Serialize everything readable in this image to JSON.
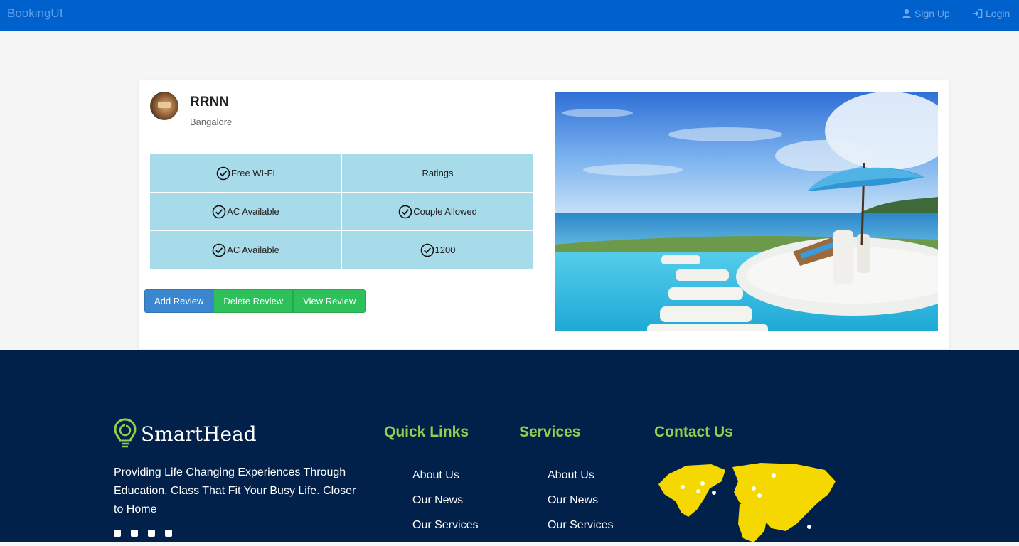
{
  "navbar": {
    "brand": "BookingUI",
    "signup_label": "Sign Up",
    "login_label": "Login"
  },
  "hotel": {
    "name": "RRNN",
    "city": "Bangalore",
    "features": [
      {
        "label": "Free WI-FI",
        "check": true
      },
      {
        "label": "Ratings",
        "check": false
      },
      {
        "label": "AC Available",
        "check": true
      },
      {
        "label": "Couple Allowed",
        "check": true
      },
      {
        "label": "AC Available",
        "check": true
      },
      {
        "label": "1200",
        "check": true
      }
    ]
  },
  "actions": {
    "add_review": "Add Review",
    "delete_review": "Delete Review",
    "view_review": "View Review"
  },
  "footer": {
    "logo_text": "SmartHead",
    "description": "Providing Life Changing Experiences Through Education. Class That Fit Your Busy Life. Closer to Home",
    "social_icons": [
      "facebook-icon",
      "twitter-icon",
      "google-plus-icon",
      "email-icon"
    ],
    "quick_links": {
      "title": "Quick Links",
      "items": [
        "About Us",
        "Our News",
        "Our Services"
      ]
    },
    "services": {
      "title": "Services",
      "items": [
        "About Us",
        "Our News",
        "Our Services"
      ]
    },
    "contact": {
      "title": "Contact Us"
    }
  },
  "colors": {
    "navbar": "#0060cc",
    "feature_cell": "#a8dbea",
    "button_blue": "#3a87cf",
    "button_green": "#2ec05a",
    "footer_bg": "#02214a",
    "footer_heading": "#8fd14f",
    "map_yellow": "#f5d800"
  }
}
